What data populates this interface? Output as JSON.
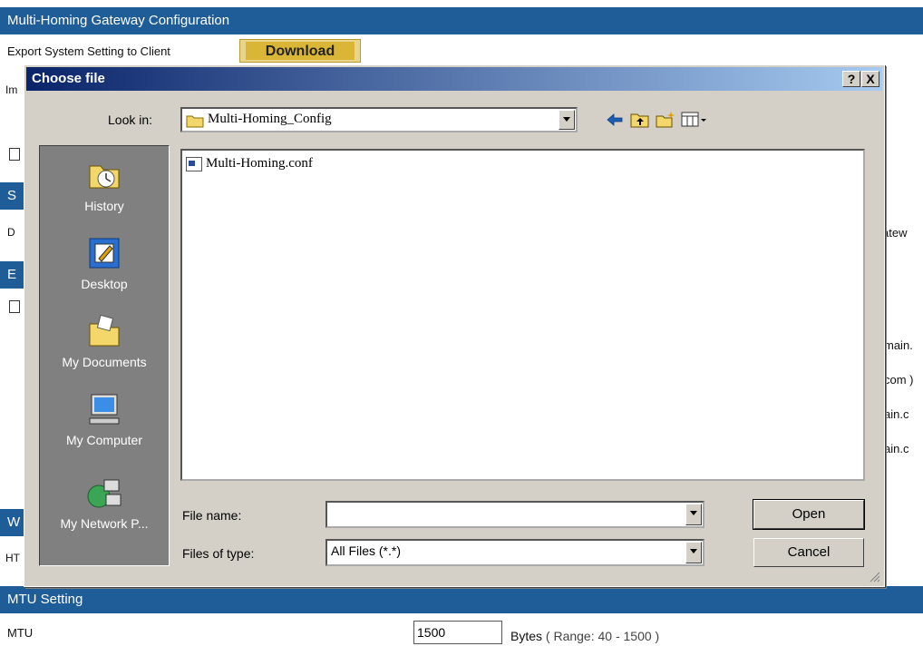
{
  "background": {
    "header_title": "Multi-Homing Gateway Configuration",
    "export_label": "Export System Setting to Client",
    "download_label": "Download",
    "clipped_left": [
      "Im",
      "S",
      "D",
      "E",
      "W",
      "HT"
    ],
    "clipped_right": [
      "atew",
      "main.",
      "com )",
      "ain.c",
      "ain.c"
    ],
    "mtu_header": "MTU Setting",
    "mtu_label": "MTU",
    "mtu_value": "1500",
    "mtu_units": "Bytes",
    "mtu_range": "( Range: 40 - 1500 )"
  },
  "dialog": {
    "title": "Choose file",
    "help_label": "?",
    "close_label": "X",
    "look_in_label": "Look in:",
    "look_in_value": "Multi-Homing_Config",
    "places": [
      {
        "label": "History",
        "icon": "history-icon"
      },
      {
        "label": "Desktop",
        "icon": "desktop-icon"
      },
      {
        "label": "My Documents",
        "icon": "my-documents-icon"
      },
      {
        "label": "My Computer",
        "icon": "my-computer-icon"
      },
      {
        "label": "My Network P...",
        "icon": "my-network-places-icon"
      }
    ],
    "files": [
      "Multi-Homing.conf"
    ],
    "file_name_label": "File name:",
    "file_name_value": "",
    "file_type_label": "Files of type:",
    "file_type_value": "All Files (*.*)",
    "open_label": "Open",
    "cancel_label": "Cancel"
  }
}
